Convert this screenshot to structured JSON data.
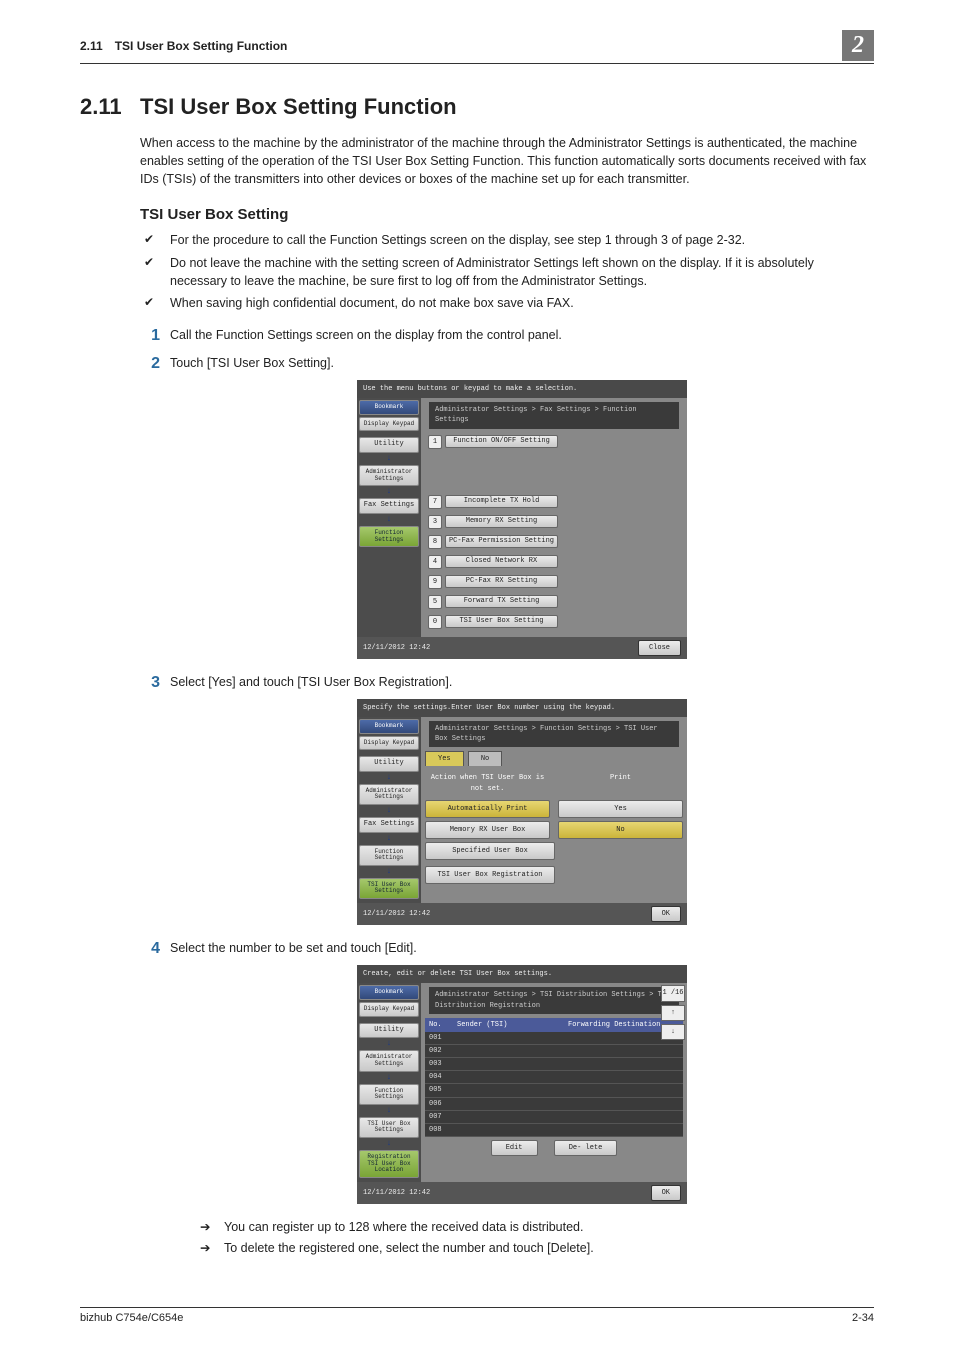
{
  "running_head": {
    "section_no": "2.11",
    "title": "TSI User Box Setting Function",
    "badge": "2"
  },
  "h1": {
    "no": "2.11",
    "title": "TSI User Box Setting Function"
  },
  "intro": "When access to the machine by the administrator of the machine through the Administrator Settings is authenticated, the machine enables setting of the operation of the TSI User Box Setting Function. This function automatically sorts documents received with fax IDs (TSIs) of the transmitters into other devices or boxes of the machine set up for each transmitter.",
  "h2": "TSI User Box Setting",
  "checks": [
    "For the procedure to call the Function Settings screen on the display, see step 1 through 3 of page 2-32.",
    "Do not leave the machine with the setting screen of Administrator Settings left shown on the display. If it is absolutely necessary to leave the machine, be sure first to log off from the Administrator Settings.",
    "When saving high confidential document, do not make box save via FAX."
  ],
  "steps": {
    "s1": "Call the Function Settings screen on the display from the control panel.",
    "s2": "Touch [TSI User Box Setting].",
    "s3": "Select [Yes] and touch [TSI User Box Registration].",
    "s4": "Select the number to be set and touch [Edit]."
  },
  "arrows": [
    "You can register up to 128 where the received data is distributed.",
    "To delete the registered one, select the number and touch [Delete]."
  ],
  "footer": {
    "left": "bizhub C754e/C654e",
    "right": "2-34"
  },
  "screen1": {
    "top": "Use the menu buttons or keypad to make a selection.",
    "crumb": "Administrator Settings > Fax Settings > Function Settings",
    "side": {
      "bookmark": "Bookmark",
      "display": "Display Keypad",
      "utility": "Utility",
      "admin": "Administrator Settings",
      "fax": "Fax Settings",
      "func": "Function Settings"
    },
    "options": {
      "o1": "Function ON/OFF Setting",
      "o3": "Memory RX Setting",
      "o4": "Closed Network RX",
      "o5": "Forward TX Setting",
      "o7": "Incomplete TX Hold",
      "o8": "PC-Fax Permission Setting",
      "o9": "PC-Fax RX Setting",
      "o0": "TSI User Box Setting"
    },
    "foot": {
      "dt": "12/11/2012   12:42",
      "close": "Close"
    }
  },
  "screen2": {
    "top1": "Specify the settings.",
    "top2": "Enter User Box number using the keypad.",
    "crumb": "Administrator Settings > Function Settings > TSI User Box Settings",
    "side": {
      "bookmark": "Bookmark",
      "display": "Display Keypad",
      "utility": "Utility",
      "admin": "Administrator Settings",
      "fax": "Fax Settings",
      "func": "Function Settings",
      "tsi": "TSI User Box Settings"
    },
    "tabs": {
      "yes": "Yes",
      "no": "No"
    },
    "rows": {
      "action_title": "Action when TSI User Box is not set.",
      "print_title": "Print",
      "auto_print": "Automatically Print",
      "yes": "Yes",
      "memory": "Memory RX User Box",
      "no": "No",
      "specified": "Specified User Box",
      "reg": "TSI User Box Registration"
    },
    "foot": {
      "dt": "12/11/2012   12:42",
      "ok": "OK"
    }
  },
  "screen3": {
    "top": "Create, edit or delete TSI User Box settings.",
    "crumb": "Administrator Settings > TSI Distribution Settings > TSI Distribution Registration",
    "side": {
      "bookmark": "Bookmark",
      "display": "Display Keypad",
      "utility": "Utility",
      "admin": "Administrator Settings",
      "func": "Function Settings",
      "tsi": "TSI User Box Settings",
      "reg": "Registration TSI User Box Location"
    },
    "hdr": {
      "no": "No.",
      "sender": "Sender (TSI)",
      "dest": "Forwarding Destination"
    },
    "rows": [
      "001",
      "002",
      "003",
      "004",
      "005",
      "006",
      "007",
      "008"
    ],
    "page": "1 /16",
    "up": "↑",
    "down": "↓",
    "edit": "Edit",
    "delete": "De- lete",
    "foot": {
      "dt": "12/11/2012   12:42",
      "ok": "OK"
    }
  }
}
